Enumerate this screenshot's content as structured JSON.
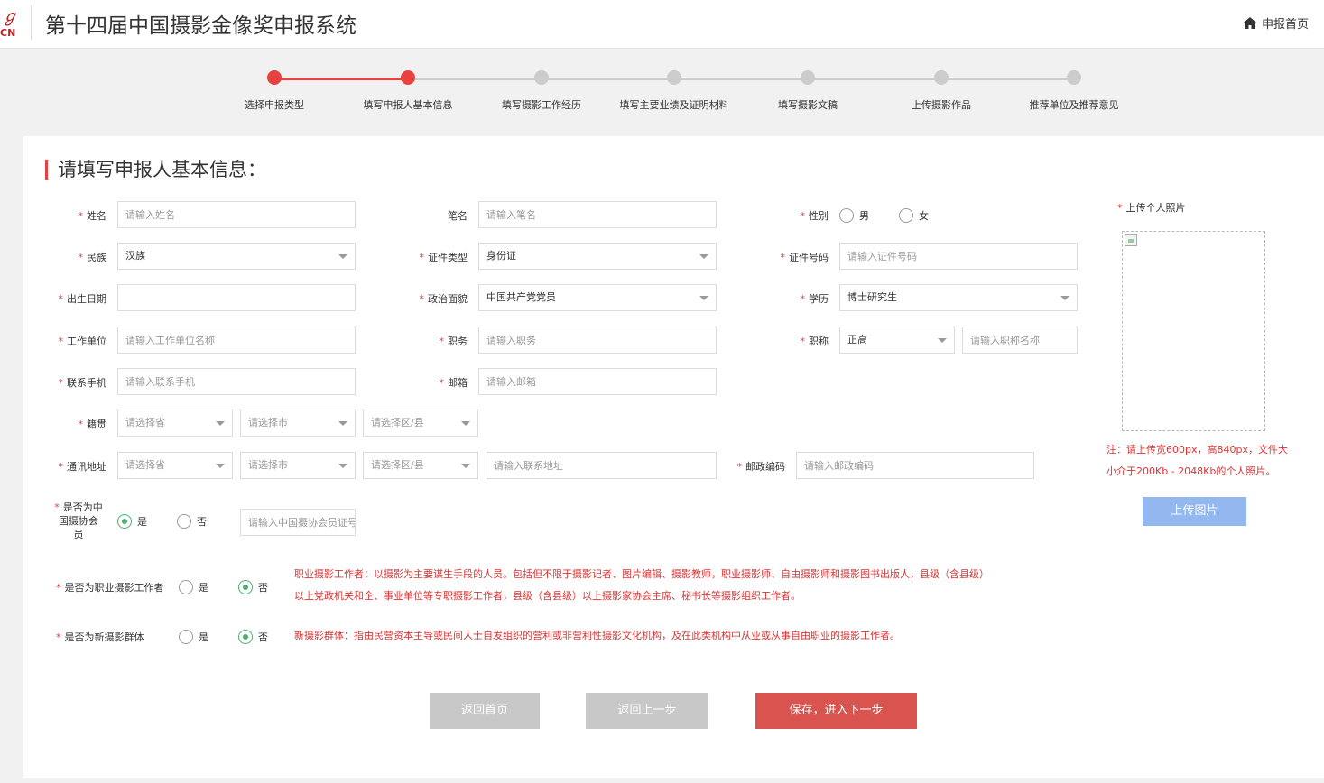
{
  "header": {
    "logo_glyph": "ℊ",
    "logo_text": "CN",
    "title": "第十四届中国摄影金像奖申报系统",
    "home_label": "申报首页"
  },
  "steps": [
    {
      "label": "选择申报类型",
      "state": "done"
    },
    {
      "label": "填写申报人基本信息",
      "state": "current"
    },
    {
      "label": "填写摄影工作经历",
      "state": "todo"
    },
    {
      "label": "填写主要业绩及证明材料",
      "state": "todo"
    },
    {
      "label": "填写摄影文稿",
      "state": "todo"
    },
    {
      "label": "上传摄影作品",
      "state": "todo"
    },
    {
      "label": "推荐单位及推荐意见",
      "state": "todo"
    }
  ],
  "form": {
    "section_title": "请填写申报人基本信息：",
    "name": {
      "label": "姓名",
      "placeholder": "请输入姓名"
    },
    "penname": {
      "label": "笔名",
      "placeholder": "请输入笔名"
    },
    "gender": {
      "label": "性别",
      "male": "男",
      "female": "女"
    },
    "ethnicity": {
      "label": "民族",
      "value": "汉族"
    },
    "id_type": {
      "label": "证件类型",
      "value": "身份证"
    },
    "id_number": {
      "label": "证件号码",
      "placeholder": "请输入证件号码"
    },
    "birthdate": {
      "label": "出生日期"
    },
    "political": {
      "label": "政治面貌",
      "value": "中国共产党党员"
    },
    "education": {
      "label": "学历",
      "value": "博士研究生"
    },
    "employer": {
      "label": "工作单位",
      "placeholder": "请输入工作单位名称"
    },
    "position": {
      "label": "职务",
      "placeholder": "请输入职务"
    },
    "title_rank": {
      "label": "职称",
      "value": "正高",
      "placeholder": "请输入职称名称"
    },
    "mobile": {
      "label": "联系手机",
      "placeholder": "请输入联系手机"
    },
    "email": {
      "label": "邮箱",
      "placeholder": "请输入邮箱"
    },
    "native": {
      "label": "籍贯",
      "province": "请选择省",
      "city": "请选择市",
      "district": "请选择区/县"
    },
    "address": {
      "label": "通讯地址",
      "province": "请选择省",
      "city": "请选择市",
      "district": "请选择区/县",
      "placeholder": "请输入联系地址"
    },
    "postcode": {
      "label": "邮政编码",
      "placeholder": "请输入邮政编码"
    },
    "cpa_member": {
      "label_line1": "是否为中",
      "label_line2": "国摄协会",
      "label_line3": "员",
      "yes": "是",
      "no": "否",
      "placeholder": "请输入中国摄协会员证号"
    },
    "professional": {
      "label": "是否为职业摄影工作者",
      "yes": "是",
      "no": "否",
      "note_line1": "职业摄影工作者：以摄影为主要谋生手段的人员。包括但不限于摄影记者、图片编辑、摄影教师，职业摄影师、自由摄影师和摄影图书出版人，县级（含县级）",
      "note_line2": "以上党政机关和企、事业单位等专职摄影工作者，县级（含县级）以上摄影家协会主席、秘书长等摄影组织工作者。"
    },
    "new_group": {
      "label": "是否为新摄影群体",
      "yes": "是",
      "no": "否",
      "note": "新摄影群体：指由民营资本主导或民间人士自发组织的营利或非营利性摄影文化机构，及在此类机构中从业或从事自由职业的摄影工作者。"
    }
  },
  "photo": {
    "label": "上传个人照片",
    "note_line1": "注：请上传宽600px，高840px，文件大",
    "note_line2": "小介于200Kb - 2048Kb的个人照片。",
    "upload_label": "上传图片"
  },
  "buttons": {
    "home": "返回首页",
    "back": "返回上一步",
    "next": "保存，进入下一步"
  }
}
